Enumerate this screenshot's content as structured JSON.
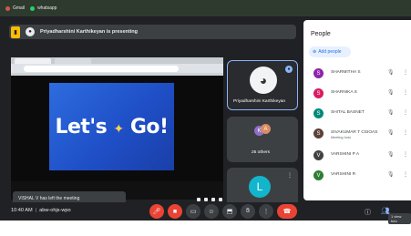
{
  "chrome": {
    "tabs": [
      "Gmail",
      "whatsapp"
    ]
  },
  "meet": {
    "presenting_text": "Priyadharshini Karthikeyan is presenting",
    "slide_text_main": "Let's",
    "slide_text_end": "Go!",
    "toast": "VISHAL V has left the meeting",
    "tiles": {
      "presenter": "Priyadharshini Karthikeyan",
      "others": "25 others",
      "self": "You",
      "self_initial": "L",
      "group_a": "K",
      "group_b": "A"
    }
  },
  "controls": {
    "time": "10:40 AM",
    "meeting_code": "abw-ohjs-wpo",
    "tooltip": "1 view tuto"
  },
  "people": {
    "title": "People",
    "add_label": "Add people",
    "list": [
      {
        "name": "SHARMITHA S",
        "initial": "S",
        "color": "#8e24aa",
        "sub": ""
      },
      {
        "name": "SHARNIKA S",
        "initial": "S",
        "color": "#d81b60",
        "sub": ""
      },
      {
        "name": "SHITAL BASNET",
        "initial": "S",
        "color": "#00897b",
        "sub": ""
      },
      {
        "name": "SIVAKUMAR T CSIOAS",
        "initial": "S",
        "color": "#5d4037",
        "sub": "Meeting host"
      },
      {
        "name": "VARSHINI P A",
        "initial": "V",
        "color": "#424242",
        "sub": ""
      },
      {
        "name": "VARSHINI R",
        "initial": "V",
        "color": "#2e7d32",
        "sub": ""
      }
    ]
  }
}
